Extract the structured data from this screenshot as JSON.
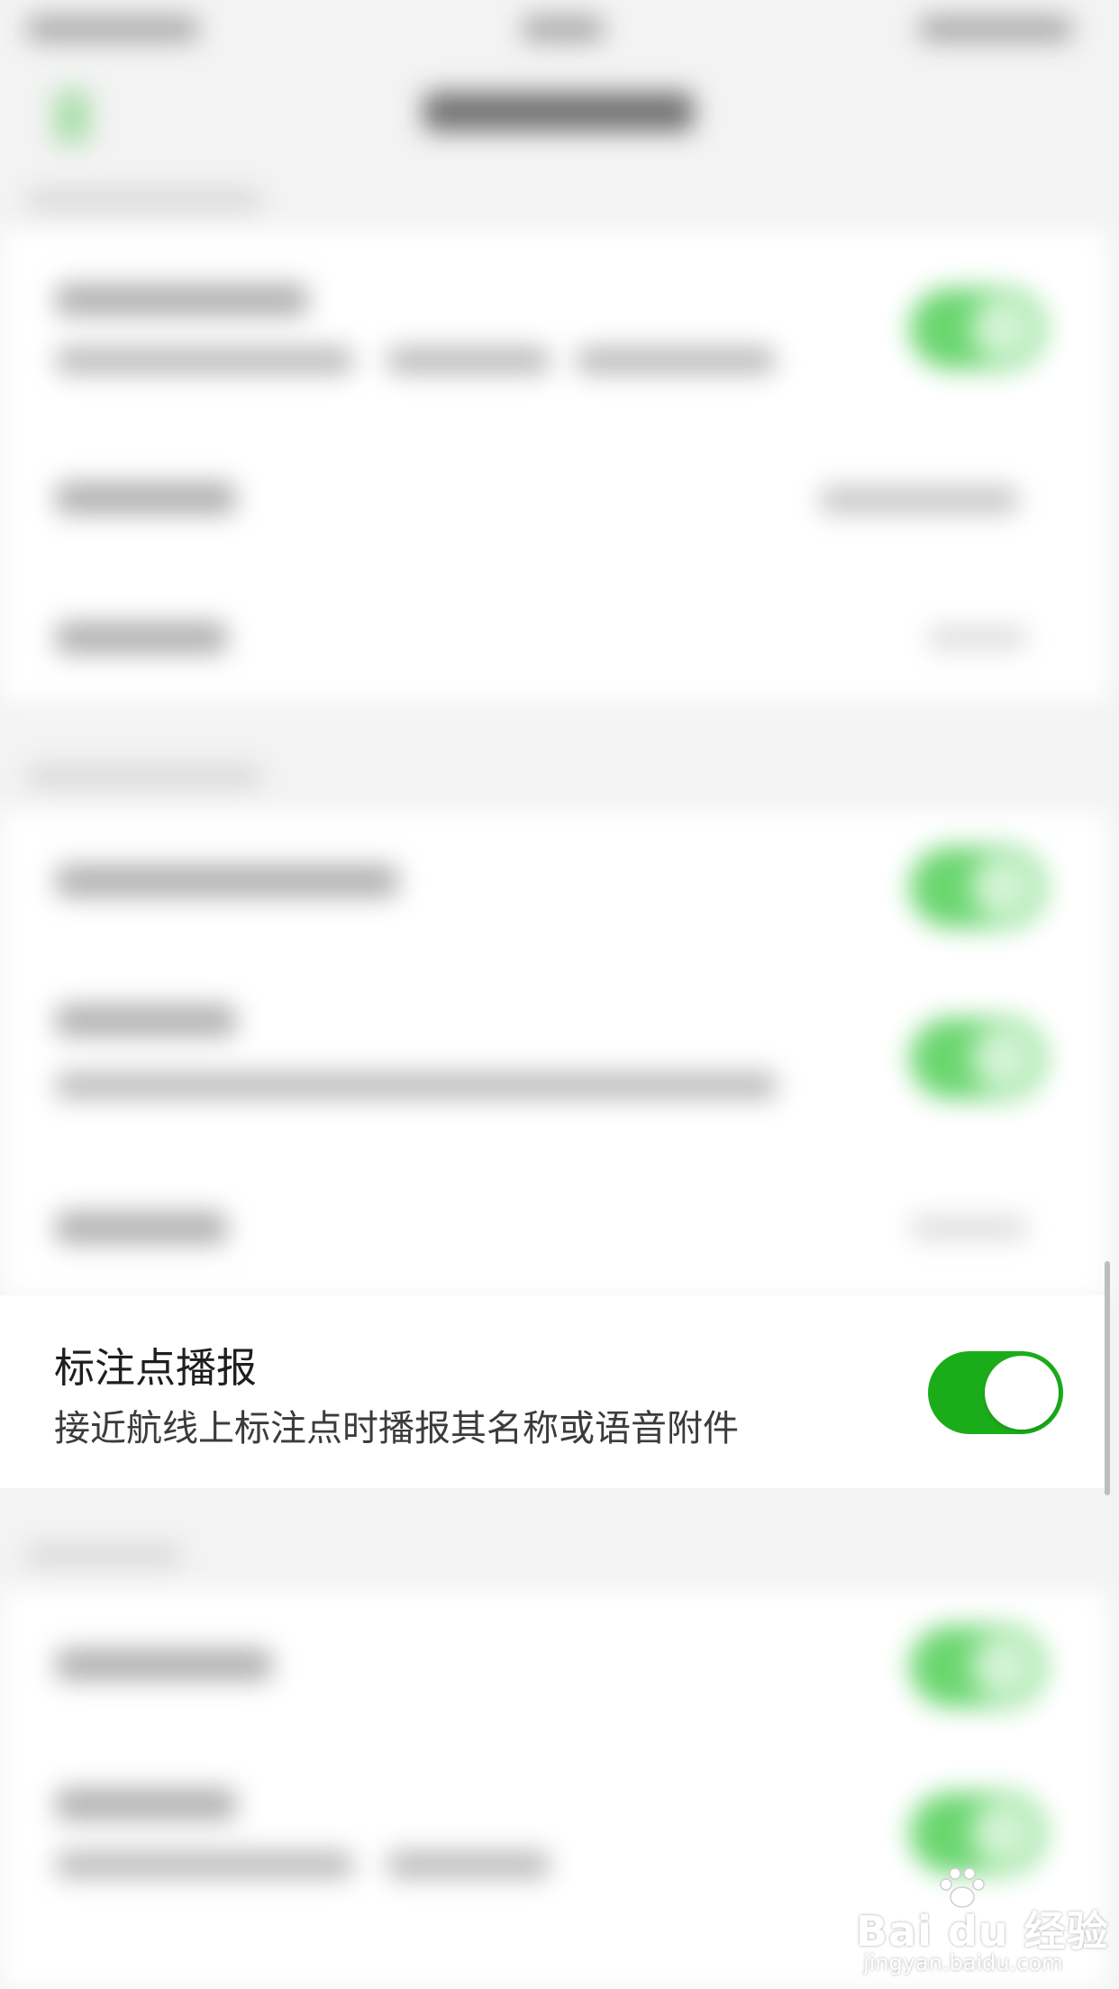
{
  "setting": {
    "title": "标注点播报",
    "description": "接近航线上标注点时播报其名称或语音附件",
    "toggle_on": true
  },
  "colors": {
    "toggle_on": "#1aad19",
    "background": "#f3f3f3"
  },
  "watermark": {
    "logo": "Bai du 经验",
    "url": "jingyan.baidu.com"
  }
}
